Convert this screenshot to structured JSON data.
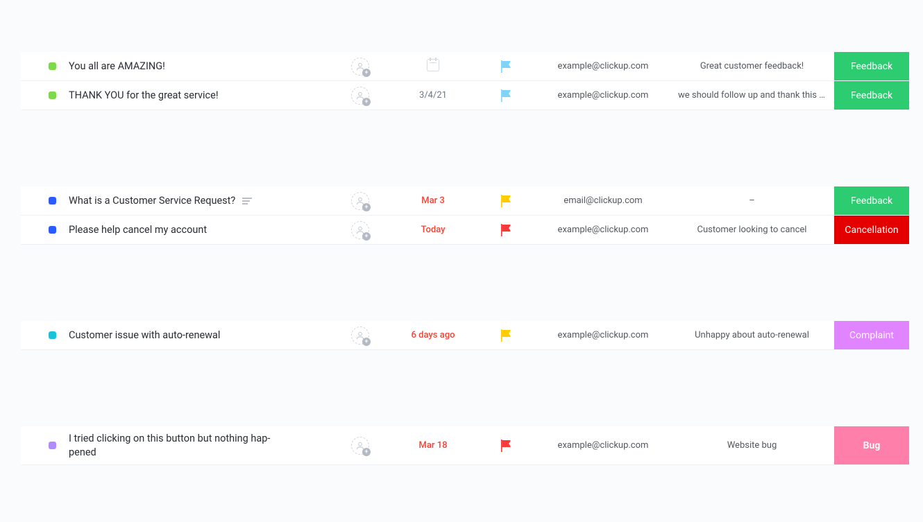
{
  "groups": [
    {
      "rows": [
        {
          "status_color": "#7bd94b",
          "title": "You all are AMAZING!",
          "has_desc_icon": false,
          "date": "",
          "date_style": "empty",
          "flag_color": "#7ed3f7",
          "email": "example@clickup.com",
          "note": "Great customer feedback!",
          "tag_label": "Feedback",
          "tag_class": "tag-green",
          "tall": false
        },
        {
          "status_color": "#7bd94b",
          "title": "THANK YOU for the great service!",
          "has_desc_icon": false,
          "date": "3/4/21",
          "date_style": "gray",
          "flag_color": "#7ed3f7",
          "email": "example@clickup.com",
          "note": "we should follow up and thank this user...",
          "tag_label": "Feedback",
          "tag_class": "tag-green",
          "tall": false
        }
      ]
    },
    {
      "rows": [
        {
          "status_color": "#2a5bff",
          "title": "What is a Customer Service Request?",
          "has_desc_icon": true,
          "date": "Mar 3",
          "date_style": "red",
          "flag_color": "#ffcc00",
          "email": "email@clickup.com",
          "note": "–",
          "tag_label": "Feedback",
          "tag_class": "tag-green",
          "tall": false
        },
        {
          "status_color": "#2a5bff",
          "title": "Please help cancel my account",
          "has_desc_icon": false,
          "date": "Today",
          "date_style": "red",
          "flag_color": "#f93a3a",
          "email": "example@clickup.com",
          "note": "Customer looking to cancel",
          "tag_label": "Cancellation",
          "tag_class": "tag-red",
          "tall": false
        }
      ]
    },
    {
      "rows": [
        {
          "status_color": "#1ac3d9",
          "title": "Customer issue with auto-renewal",
          "has_desc_icon": false,
          "date": "6 days ago",
          "date_style": "red",
          "flag_color": "#ffcc00",
          "email": "example@clickup.com",
          "note": "Unhappy about auto-renewal",
          "tag_label": "Complaint",
          "tag_class": "tag-violet",
          "tall": false
        }
      ]
    },
    {
      "rows": [
        {
          "status_color": "#b18cff",
          "title": "I tried clicking on this button but nothing hap­pened",
          "has_desc_icon": false,
          "date": "Mar 18",
          "date_style": "red",
          "flag_color": "#f93a3a",
          "email": "example@clickup.com",
          "note": "Website bug",
          "tag_label": "Bug",
          "tag_class": "tag-pink",
          "tall": true
        }
      ]
    }
  ]
}
